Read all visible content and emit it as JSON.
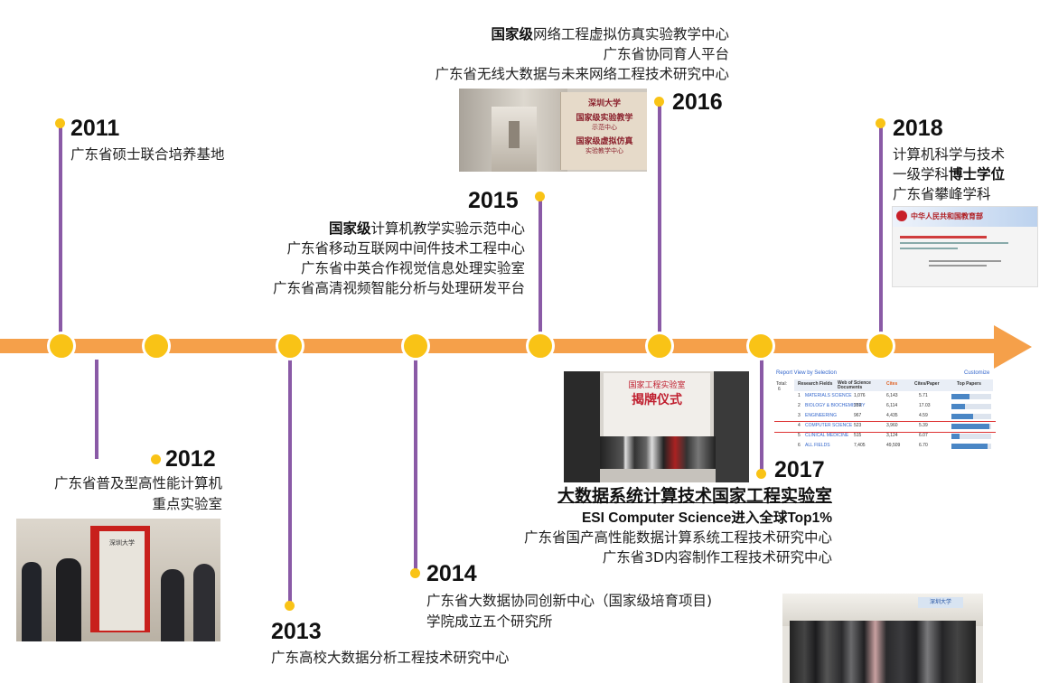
{
  "colors": {
    "axis": "#f5a04a",
    "node": "#f9c316",
    "stem": "#8a5aa6"
  },
  "y2011": {
    "year": "2011",
    "lines": [
      "广东省硕士联合培养基地"
    ]
  },
  "y2012": {
    "year": "2012",
    "lines": [
      "广东省普及型高性能计算机",
      "重点实验室"
    ]
  },
  "y2013": {
    "year": "2013",
    "lines": [
      "广东高校大数据分析工程技术研究中心"
    ]
  },
  "y2014": {
    "year": "2014",
    "lines": [
      "广东省大数据协同创新中心（国家级培育项目)",
      "学院成立五个研究所"
    ]
  },
  "y2015": {
    "year": "2015",
    "l1_bold": "国家级",
    "l1_rest": "计算机教学实验示范中心",
    "lines": [
      "广东省移动互联网中间件技术工程中心",
      "广东省中英合作视觉信息处理实验室",
      "广东省高清视频智能分析与处理研发平台"
    ]
  },
  "y2016": {
    "year": "2016",
    "l1_bold": "国家级",
    "l1_rest": "网络工程虚拟仿真实验教学中心",
    "lines": [
      "广东省协同育人平台",
      "广东省无线大数据与未来网络工程技术研究中心"
    ]
  },
  "y2017": {
    "year": "2017",
    "headline": "大数据系统计算技术国家工程实验室",
    "esi": "ESI Computer Science进入全球Top1%",
    "lines": [
      "广东省国产高性能数据计算系统工程技术研究中心",
      "广东省3D内容制作工程技术研究中心"
    ]
  },
  "y2018": {
    "year": "2018",
    "l1": "计算机科学与技术",
    "l2_pre": "一级学科",
    "l2_bold": "博士学位",
    "l3": "广东省攀峰学科"
  },
  "photos": {
    "sign2016": {
      "title": "深圳大学",
      "lines": [
        "国家级实验教学",
        "示范中心",
        "国家级虚拟仿真",
        "实验教学中心"
      ]
    },
    "moe2018": {
      "header": "中华人民共和国教育部"
    },
    "ceremony2017": {
      "title": "国家工程实验室",
      "subtitle": "揭牌仪式"
    },
    "esi_table": {
      "title": "Report View by Selection",
      "link": "Customize",
      "total_label": "Total:",
      "total_value": "6",
      "headers": [
        "Research Fields",
        "Web of Science Documents",
        "Cites",
        "Cites/Paper",
        "Top Papers"
      ],
      "rows": [
        {
          "n": "1",
          "field": "MATERIALS SCIENCE",
          "docs": "1,076",
          "cites": "6,143",
          "cpp": "5.71",
          "bar": 0.45
        },
        {
          "n": "2",
          "field": "BIOLOGY & BIOCHEMISTRY",
          "docs": "359",
          "cites": "6,114",
          "cpp": "17.03",
          "bar": 0.35
        },
        {
          "n": "3",
          "field": "ENGINEERING",
          "docs": "967",
          "cites": "4,435",
          "cpp": "4.59",
          "bar": 0.55
        },
        {
          "n": "4",
          "field": "COMPUTER SCIENCE",
          "docs": "523",
          "cites": "3,960",
          "cpp": "5.39",
          "bar": 0.95
        },
        {
          "n": "5",
          "field": "CLINICAL MEDICINE",
          "docs": "515",
          "cites": "3,124",
          "cpp": "6.07",
          "bar": 0.2
        },
        {
          "n": "6",
          "field": "ALL FIELDS",
          "docs": "7,405",
          "cites": "49,509",
          "cpp": "6.70",
          "bar": 0.9
        }
      ]
    },
    "plaque2012": {
      "title": "深圳大学"
    },
    "group2017": {
      "title": "深圳大学"
    }
  }
}
